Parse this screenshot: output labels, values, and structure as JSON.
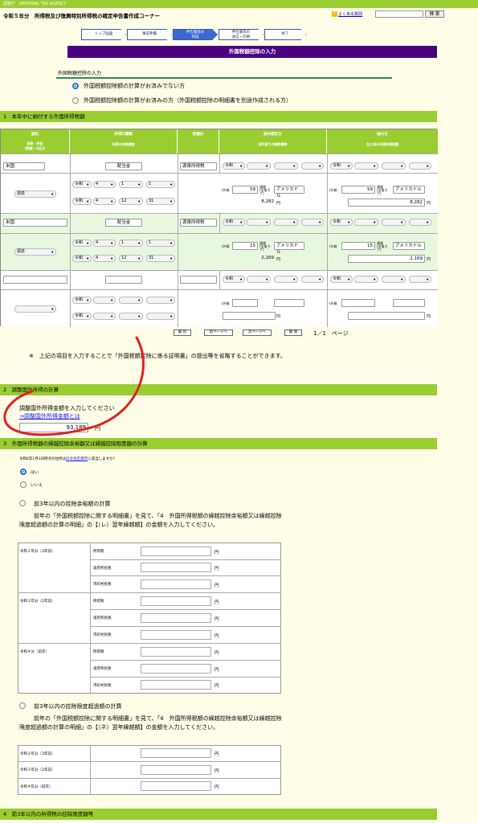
{
  "agency": "国税庁　NATIONAL TAX AGENCY",
  "header": {
    "title": "令和５年分　所得税及び復興特別所得税の確定申告書作成コーナー",
    "help_icon": "?",
    "help_link": "よくある質問",
    "search_button": "検 索"
  },
  "steps": [
    {
      "label": "トップ画面"
    },
    {
      "label": "事前準備"
    },
    {
      "label": "申告書等の",
      "label2": "作成"
    },
    {
      "label": "申告書等の",
      "label2": "送信・印刷"
    },
    {
      "label": "終了"
    }
  ],
  "banner": "外国税額控除の入力",
  "section_input": "外国税額控除の入力",
  "radios": {
    "opt1": "外国税額控除額の計算がお済みでない方",
    "opt2": "外国税額控除額の計算がお済みの方（外国税額控除の明細書を別途作成される方）"
  },
  "sec1": "1　本年中に納付する外国所得税額",
  "table": {
    "h_country": "国名",
    "h_type": "所得の種類",
    "h_tax": "税種目",
    "h_date": "納付確定日",
    "h_pay": "納付日",
    "s_country": "源泉・申告\n(賦課）の区分",
    "s_type": "所得の計算期間",
    "s_date": "相手国での課税標準",
    "s_pay": "左に係る外国所得税額",
    "rows": [
      {
        "country": "米国",
        "type": "配当金",
        "tax": "源泉所得税",
        "era": "令和",
        "kubun": "源泉",
        "p1": [
          "令和",
          "4",
          "1",
          "1"
        ],
        "p2": [
          "令和",
          "4",
          "12",
          "31"
        ],
        "cur": "アメリカドル",
        "fx_label": "(外貨",
        "v1": "59",
        "yen1": "8,282",
        "v2": "59",
        "yen2": "8,282"
      },
      {
        "country": "米国",
        "type": "配当金",
        "tax": "源泉所得税",
        "era": "令和",
        "kubun": "源泉",
        "p1": [
          "令和",
          "4",
          "1",
          "1"
        ],
        "p2": [
          "令和",
          "4",
          "12",
          "31"
        ],
        "cur": "アメリカドル",
        "fx_label": "(外貨",
        "v1": "15",
        "yen1": "2,169",
        "v2": "15",
        "yen2": "2,169"
      }
    ],
    "era": "令和",
    "unit_yen": "円",
    "currency_note": "通貨\n(金角カナ)"
  },
  "pager": {
    "first": "最 初",
    "prev": "前ページへ",
    "next": "次ページへ",
    "last": "最 後",
    "page": "1／1　ページ"
  },
  "note": "※　上記の項目を入力することで「外国税額控除に係る証明書」の提出等を省略することができます。",
  "sec2": "2　調整国外所得の計算",
  "adj": {
    "prompt": "調整国外所得金額を入力してください",
    "link": "→調整国外所得金額とは",
    "value": "93,189",
    "unit": "円"
  },
  "sec3": "3　外国所得税額の繰越控除余裕額又は繰越控除限度額の計算",
  "q": {
    "text": "令和6年1月1日時点の住所は",
    "link": "旧令指定都市",
    "text2": "に該当しますか？",
    "yes": "はい",
    "no": "いいえ"
  },
  "yoyu": {
    "title": "前3年以内の控除余裕額の計算",
    "desc": "前年の「外国税額控除に関する明細書」を見て、「4　外国所得税額の繰越控除余裕額又は繰越控除限度超過額の計算の明細」の【（レ）翌年繰越額】の金額を入力してください。",
    "years": [
      "令和２年分（3年前）",
      "令和３年分（2年前）",
      "令和４分（前年）"
    ],
    "taxes": [
      "所得税",
      "道府県民税",
      "市町村民税"
    ]
  },
  "chokai": {
    "title": "前3年以内の控除限度超過額の計算",
    "desc": "前年の「外国税額控除に関する明細書」を見て、「4　外国所得税額の繰越控除余裕額又は繰越控除限度超過額の計算の明細」の【（ネ）翌年繰越額】の金額を入力してください。",
    "years": [
      "令和２年分（3年前）",
      "令和３年分（2年前）",
      "令和４年分（前年）"
    ]
  },
  "sec4": "4　前3年以内の所得税の控除限度額等",
  "colors": {
    "green": "#9acd32",
    "purple": "#4b0082",
    "annotation": "#e02020"
  }
}
